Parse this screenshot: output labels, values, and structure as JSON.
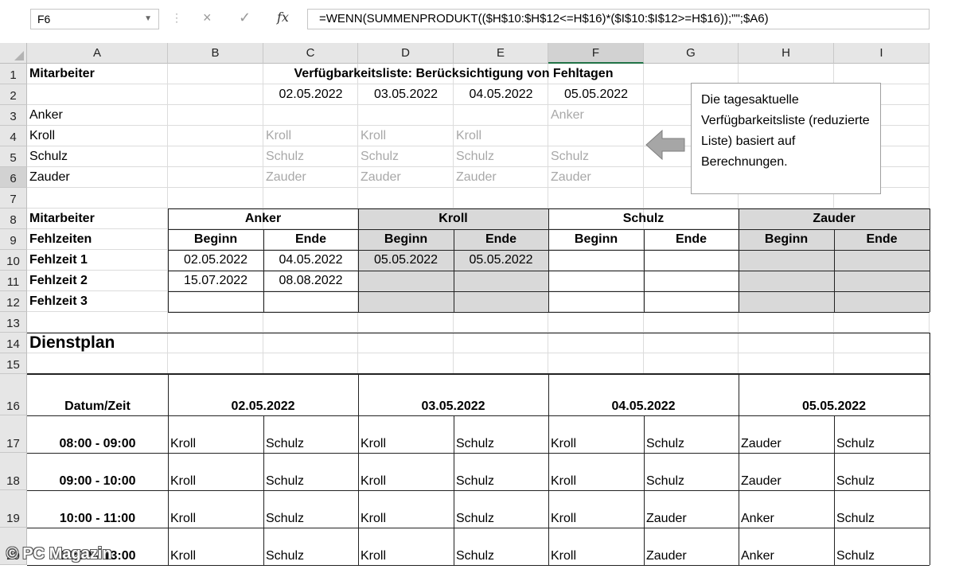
{
  "formula_bar": {
    "name_box": "F6",
    "formula": "=WENN(SUMMENPRODUKT(($H$10:$H$12<=H$16)*($I$10:$I$12>=H$16));\"\";$A6)",
    "fx_label": "fx",
    "cancel_icon": "×",
    "enter_icon": "✓"
  },
  "columns": [
    "A",
    "B",
    "C",
    "D",
    "E",
    "F",
    "G",
    "H",
    "I"
  ],
  "rows": [
    "1",
    "2",
    "3",
    "4",
    "5",
    "6",
    "7",
    "8",
    "9",
    "10",
    "11",
    "12",
    "13",
    "14",
    "15",
    "16",
    "17",
    "18",
    "19",
    "20"
  ],
  "top": {
    "a1": "Mitarbeiter",
    "title": "Verfügbarkeitsliste: Berücksichtigung von Fehltagen",
    "dates": [
      "02.05.2022",
      "03.05.2022",
      "04.05.2022",
      "05.05.2022"
    ],
    "names": [
      "Anker",
      "Kroll",
      "Schulz",
      "Zauder"
    ],
    "avail": {
      "anker": [
        "",
        "",
        "",
        "Anker"
      ],
      "kroll": [
        "Kroll",
        "Kroll",
        "Kroll",
        ""
      ],
      "schulz": [
        "Schulz",
        "Schulz",
        "Schulz",
        "Schulz"
      ],
      "zauder": [
        "Zauder",
        "Zauder",
        "Zauder",
        "Zauder"
      ]
    }
  },
  "absence": {
    "a8": "Mitarbeiter",
    "a9": "Fehlzeiten",
    "employees": [
      "Anker",
      "Kroll",
      "Schulz",
      "Zauder"
    ],
    "begin": "Beginn",
    "end": "Ende",
    "rows": [
      {
        "label": "Fehlzeit 1",
        "values": [
          "02.05.2022",
          "04.05.2022",
          "05.05.2022",
          "05.05.2022",
          "",
          "",
          "",
          ""
        ]
      },
      {
        "label": "Fehlzeit 2",
        "values": [
          "15.07.2022",
          "08.08.2022",
          "",
          "",
          "",
          "",
          "",
          ""
        ]
      },
      {
        "label": "Fehlzeit 3",
        "values": [
          "",
          "",
          "",
          "",
          "",
          "",
          "",
          ""
        ]
      }
    ]
  },
  "plan": {
    "title": "Dienstplan",
    "header_label": "Datum/Zeit",
    "dates": [
      "02.05.2022",
      "03.05.2022",
      "04.05.2022",
      "05.05.2022"
    ],
    "slots": [
      {
        "time": "08:00 - 09:00",
        "names": [
          "Kroll",
          "Schulz",
          "Kroll",
          "Schulz",
          "Kroll",
          "Schulz",
          "Zauder",
          "Schulz"
        ]
      },
      {
        "time": "09:00 - 10:00",
        "names": [
          "Kroll",
          "Schulz",
          "Kroll",
          "Schulz",
          "Kroll",
          "Schulz",
          "Zauder",
          "Schulz"
        ]
      },
      {
        "time": "10:00 - 11:00",
        "names": [
          "Kroll",
          "Schulz",
          "Kroll",
          "Schulz",
          "Kroll",
          "Zauder",
          "Anker",
          "Schulz"
        ]
      },
      {
        "time": "12:00 - 13:00",
        "names": [
          "Kroll",
          "Schulz",
          "Kroll",
          "Schulz",
          "Kroll",
          "Zauder",
          "Anker",
          "Schulz"
        ]
      }
    ]
  },
  "callout": "Die tagesaktuelle Verfügbarkeitsliste (reduzierte Liste) basiert auf Berechnungen.",
  "watermark": "© PC Magazin",
  "colors": {
    "shade": "#d9d9d9",
    "header": "#e6e6e6",
    "grey_text": "#a8a8a8"
  }
}
